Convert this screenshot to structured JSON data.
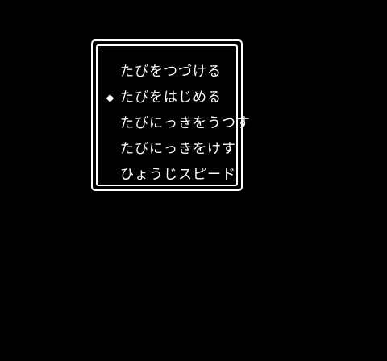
{
  "menu": {
    "cursor_glyph": "◆",
    "selected_index": 1,
    "items": [
      {
        "label": "たびをつづける"
      },
      {
        "label": "たびをはじめる"
      },
      {
        "label": "たびにっきをうつす"
      },
      {
        "label": "たびにっきをけす"
      },
      {
        "label": "ひょうじスピード"
      }
    ]
  },
  "colors": {
    "background": "#000000",
    "text": "#ffffff",
    "border": "#ffffff"
  }
}
